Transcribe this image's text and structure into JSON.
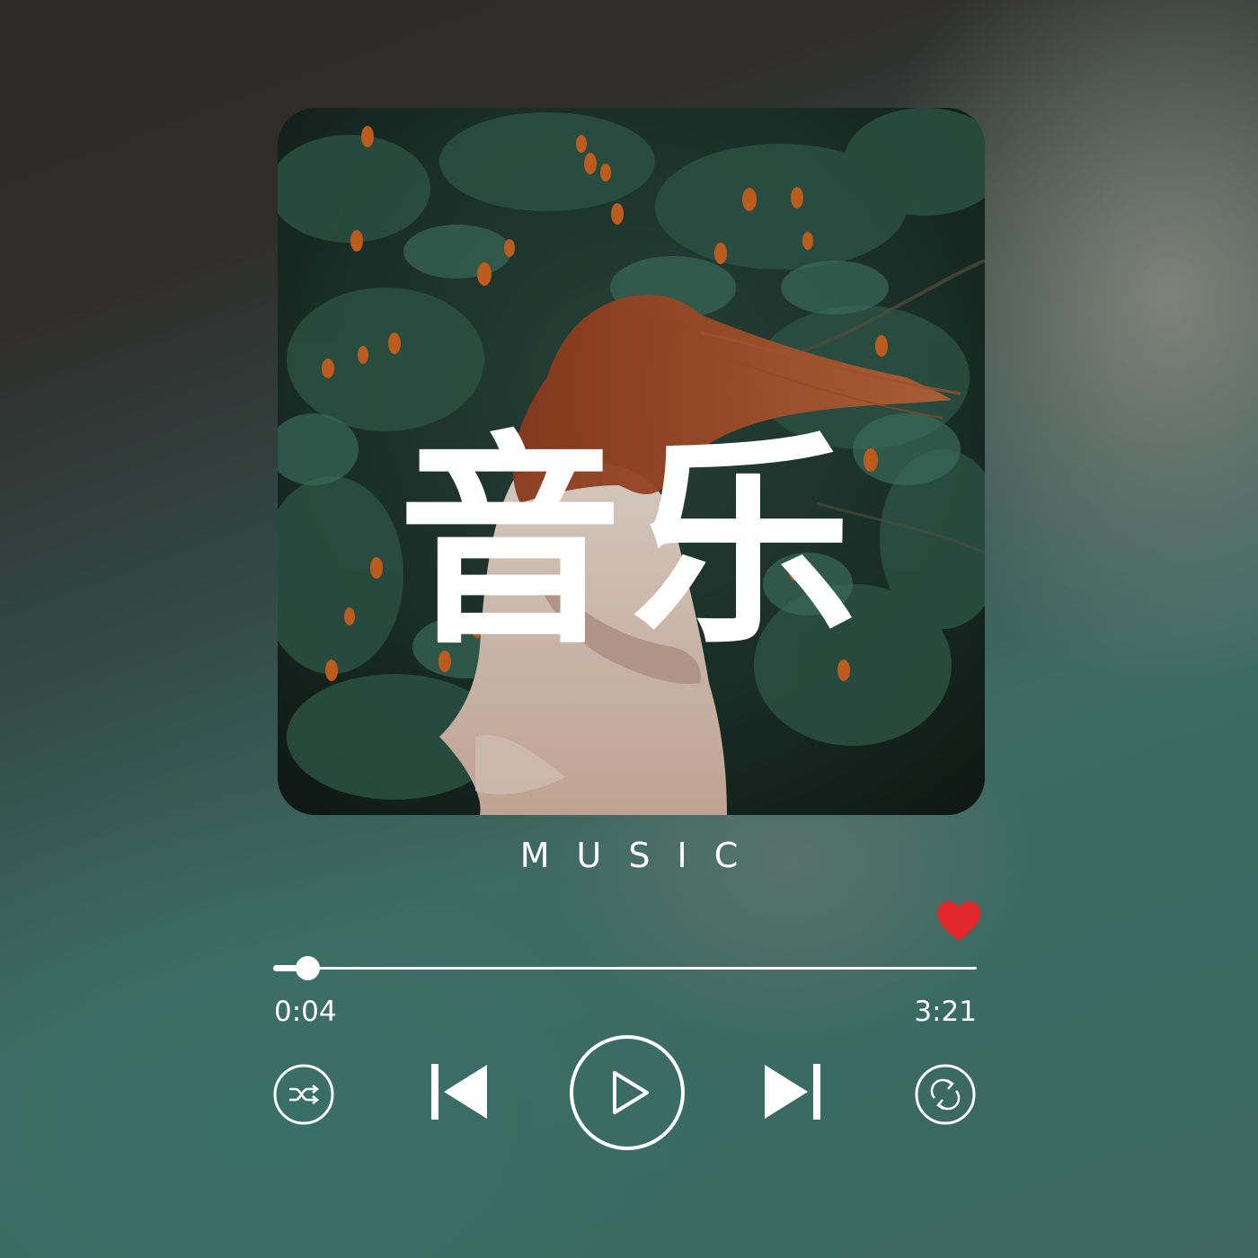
{
  "player": {
    "cover_title": "音乐",
    "caption": "MUSIC",
    "favorite": true,
    "progress_fraction": 0.048,
    "elapsed": "0:04",
    "duration": "3:21"
  },
  "icons": {
    "favorite": "heart-icon",
    "shuffle": "shuffle-icon",
    "previous": "skip-previous-icon",
    "play": "play-icon",
    "next": "skip-next-icon",
    "repeat": "repeat-icon"
  },
  "colors": {
    "heart": "#e0272a",
    "foreground": "#ffffff"
  }
}
